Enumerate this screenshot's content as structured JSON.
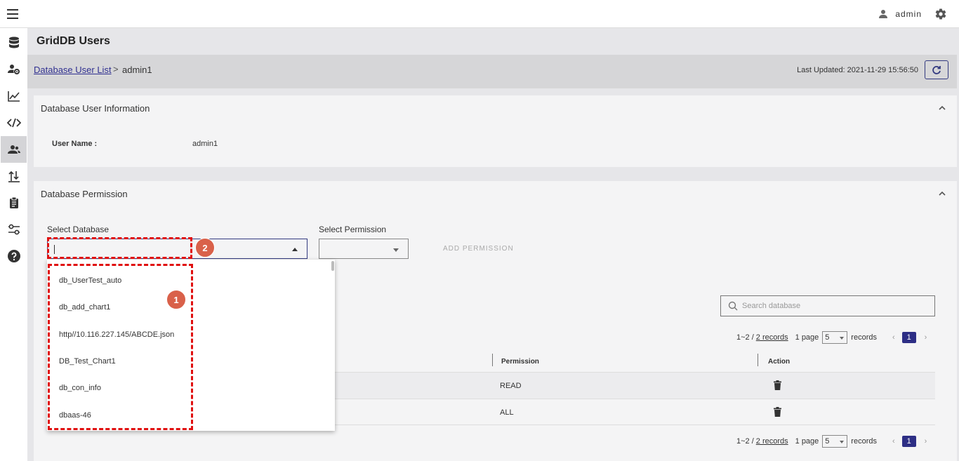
{
  "topbar": {
    "user": "admin"
  },
  "page": {
    "title": "GridDB Users"
  },
  "breadcrumb": {
    "link": "Database User List",
    "separator": ">",
    "current": "admin1"
  },
  "last_updated": "Last Updated: 2021-11-29 15:56:50",
  "user_info": {
    "title": "Database User Information",
    "label": "User Name :",
    "value": "admin1"
  },
  "permission": {
    "title": "Database Permission",
    "select_db_label": "Select Database",
    "select_perm_label": "Select Permission",
    "add_button": "ADD PERMISSION",
    "search_placeholder": "Search database"
  },
  "pager": {
    "range": "1~2 / ",
    "records_link": "2 records",
    "page_word": "1 page",
    "per_page": "5",
    "records_word": "records",
    "current_page": "1"
  },
  "table": {
    "columns": [
      "Permission",
      "Action"
    ],
    "rows": [
      {
        "permission": "READ"
      },
      {
        "permission": "ALL"
      }
    ]
  },
  "dropdown_items": [
    "db_UserTest_auto",
    "db_add_chart1",
    "http//10.116.227.145/ABCDE.json",
    "DB_Test_Chart1",
    "db_con_info",
    "dbaas-46"
  ],
  "badges": [
    "1",
    "2"
  ],
  "colors": {
    "accent": "#2d2e85",
    "annotation": "#e01010",
    "badge": "#d9614a"
  }
}
